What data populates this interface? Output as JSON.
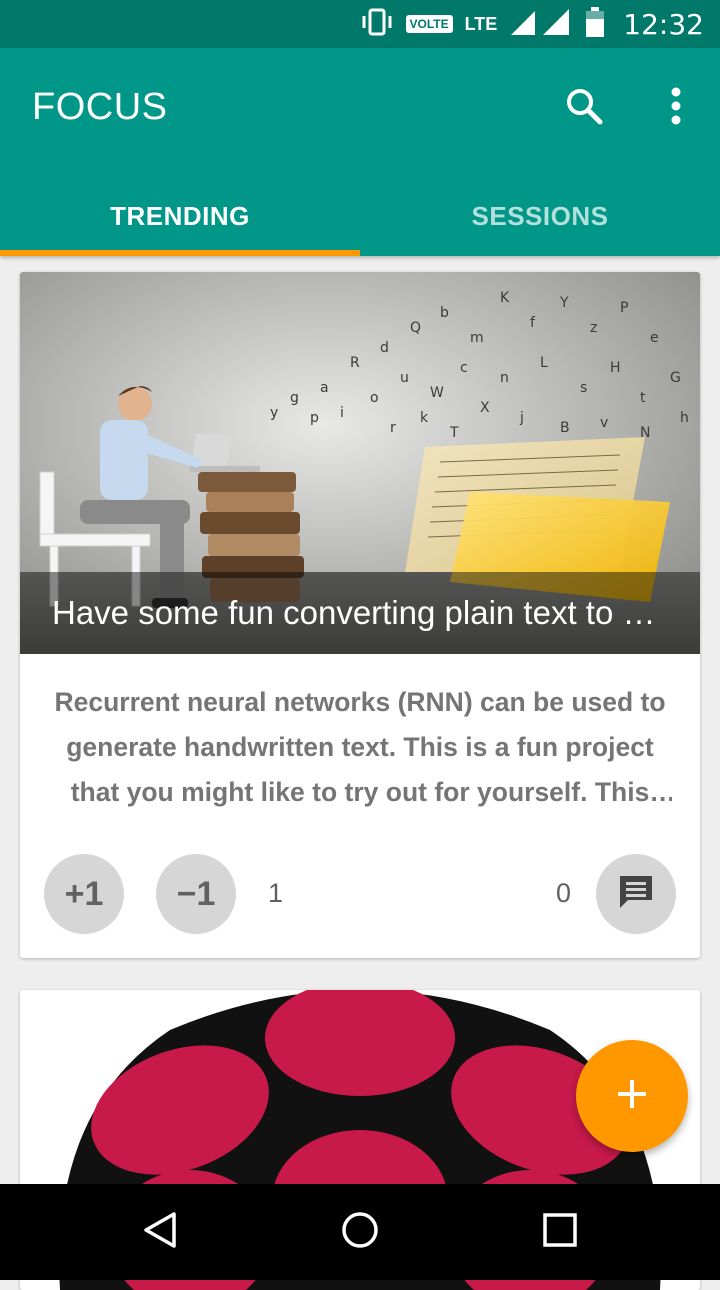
{
  "status_bar": {
    "volte": "VOLTE",
    "network": "LTE",
    "time": "12:32",
    "icons": [
      "vibrate-icon",
      "signal-icon",
      "battery-icon"
    ]
  },
  "app_bar": {
    "title": "FOCUS",
    "actions": [
      "search-icon",
      "more-vert-icon"
    ],
    "tabs": [
      {
        "label": "TRENDING",
        "active": true
      },
      {
        "label": "SESSIONS",
        "active": false
      }
    ]
  },
  "feed": [
    {
      "image": "illustration of man at laptop on stack of books with letters flying to paper",
      "title": "Have some fun converting plain text to ha…",
      "description": "Recurrent neural networks (RNN) can be used to generate handwritten text. This is a fun project that you might like to try out for yourself. This a…",
      "upvote_label": "+1",
      "downvote_label": "−1",
      "score": "1",
      "comment_count": "0"
    },
    {
      "image": "raspberry logo"
    }
  ],
  "fab": {
    "icon": "add-icon"
  },
  "nav_bar": {
    "icons": [
      "back-icon",
      "home-icon",
      "recents-icon"
    ]
  },
  "colors": {
    "primary": "#009688",
    "primary_dark": "#00796b",
    "accent": "#ff9800",
    "button_gray": "#d6d6d6",
    "raspberry": "#c8194b"
  }
}
